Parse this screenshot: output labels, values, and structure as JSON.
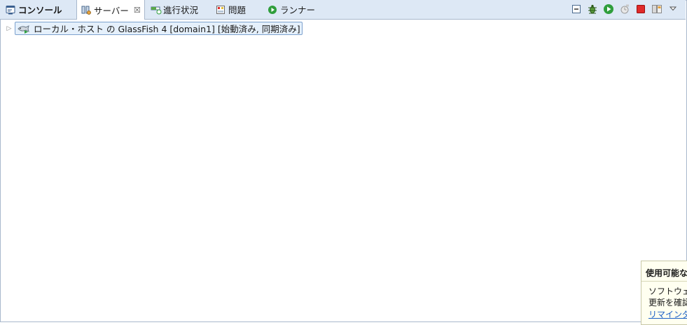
{
  "tabs": [
    {
      "label": "コンソール",
      "icon": "console-icon",
      "active": false
    },
    {
      "label": "サーバー",
      "icon": "servers-icon",
      "active": true,
      "closable": true
    },
    {
      "label": "進行状況",
      "icon": "progress-icon",
      "active": false
    },
    {
      "label": "問題",
      "icon": "problems-icon",
      "active": false
    },
    {
      "label": "ランナー",
      "icon": "runner-icon",
      "active": false
    }
  ],
  "close_glyph": "☒",
  "toolbar": [
    "collapse-icon",
    "debug-icon",
    "start-icon",
    "profile-icon",
    "stop-icon",
    "publish-icon",
    "view-menu-icon"
  ],
  "tree": {
    "expander": "▷",
    "node_label": "ローカル・ホスト の GlassFish 4 [domain1]  [始動済み, 同期済み]"
  },
  "notification": {
    "title": "使用可能な",
    "line1": "ソフトウェ",
    "line2": "更新を確認",
    "link": "リマインダ"
  },
  "colors": {
    "tabbar_bg": "#dde8f5",
    "border": "#a8b8cc",
    "selection_bg": "#e5f0fb",
    "run_green": "#2f9e3c",
    "stop_red": "#e02a2a",
    "link_blue": "#1a5fc7"
  }
}
